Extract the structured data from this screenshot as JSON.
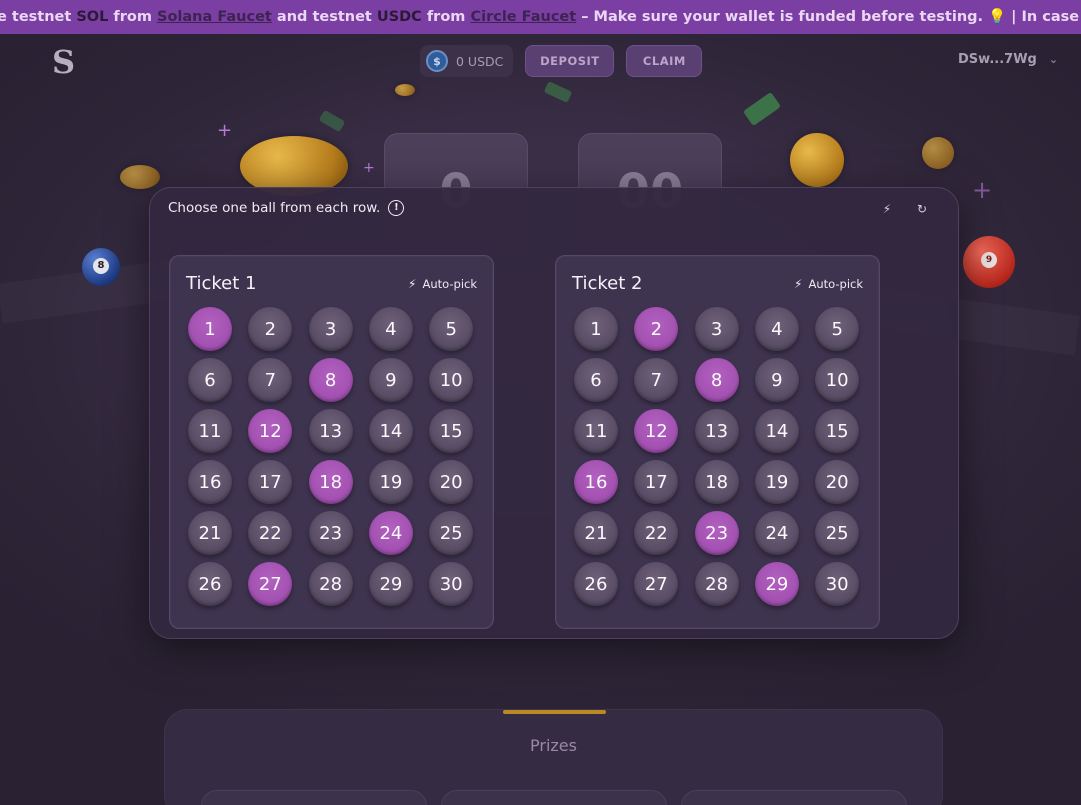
{
  "banner": {
    "t1": "e testnet ",
    "sol": "SOL",
    "t2": " from ",
    "faucet1": "Solana Faucet",
    "t3": " and testnet ",
    "usdc": "USDC",
    "t4": " from ",
    "faucet2": "Circle Faucet",
    "t5": " – Make sure your wallet is funded before testing. 💡 | In case of an"
  },
  "header": {
    "usdc_icon": "$",
    "balance": "0 USDC",
    "deposit_label": "DEPOSIT",
    "claim_label": "CLAIM",
    "wallet": "DSw...7Wg",
    "wallet_chevron": "⌄"
  },
  "background": {
    "tile1": "0",
    "tile2": "00",
    "ball8": "8",
    "ballred": "9"
  },
  "modal": {
    "instruction": "Choose one ball from each row.",
    "info_glyph": "!",
    "autopick_icon": "⚡",
    "reset_icon": "↻",
    "tickets": [
      {
        "title": "Ticket 1",
        "autopick": "Auto-pick",
        "numbers": [
          "1",
          "2",
          "3",
          "4",
          "5",
          "6",
          "7",
          "8",
          "9",
          "10",
          "11",
          "12",
          "13",
          "14",
          "15",
          "16",
          "17",
          "18",
          "19",
          "20",
          "21",
          "22",
          "23",
          "24",
          "25",
          "26",
          "27",
          "28",
          "29",
          "30"
        ],
        "selected": [
          "1",
          "8",
          "12",
          "18",
          "24",
          "27"
        ]
      },
      {
        "title": "Ticket 2",
        "autopick": "Auto-pick",
        "numbers": [
          "1",
          "2",
          "3",
          "4",
          "5",
          "6",
          "7",
          "8",
          "9",
          "10",
          "11",
          "12",
          "13",
          "14",
          "15",
          "16",
          "17",
          "18",
          "19",
          "20",
          "21",
          "22",
          "23",
          "24",
          "25",
          "26",
          "27",
          "28",
          "29",
          "30"
        ],
        "selected": [
          "2",
          "8",
          "12",
          "16",
          "23",
          "29"
        ]
      }
    ]
  },
  "prizes": {
    "title": "Prizes"
  },
  "colors": {
    "selected_ball": "#a651b5",
    "ball": "#5d5169",
    "banner": "#7b3fa3"
  }
}
